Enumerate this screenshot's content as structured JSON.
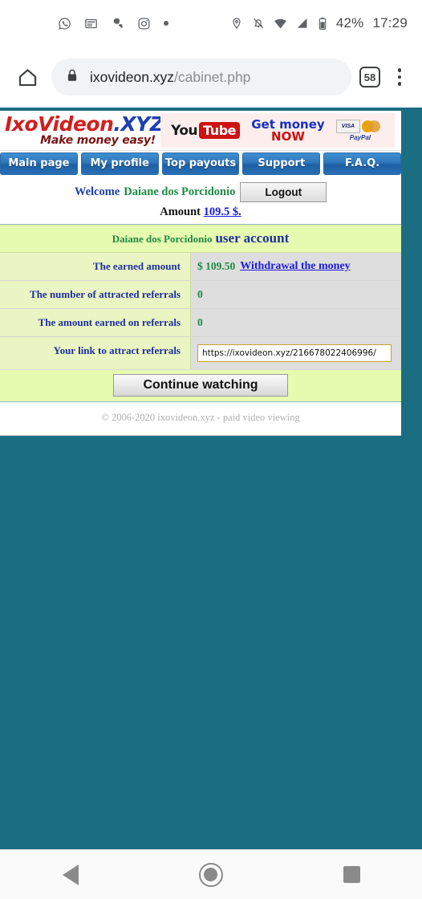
{
  "status_bar": {
    "left_icons": [
      "whatsapp-icon",
      "news-feed-icon",
      "messenger-icon",
      "instagram-icon",
      "more-notifications-dot-icon"
    ],
    "right_icons": [
      "location-pin-icon",
      "notifications-off-icon",
      "wifi-icon",
      "cellular-signal-icon",
      "battery-icon"
    ],
    "battery_percent": "42%",
    "clock": "17:29"
  },
  "browser": {
    "home_icon": "home-icon",
    "lock_icon": "lock-icon",
    "url_host": "ixovideon.xyz",
    "url_path": "/cabinet.php",
    "tab_count": "58",
    "menu_icon": "overflow-menu-icon"
  },
  "site": {
    "logo": {
      "name_part1": "IxoVideon",
      "name_part2": ".XYZ",
      "tagline": "Make money easy!"
    },
    "banner": {
      "youtube_you": "You",
      "youtube_tube": "Tube",
      "headline_line1": "Get money",
      "headline_line2": "NOW",
      "card_visa": "VISA",
      "card_paypal": "PayPal"
    },
    "nav_items": [
      {
        "label": "Main page"
      },
      {
        "label": "My profile"
      },
      {
        "label": "Top payouts"
      },
      {
        "label": "Support"
      },
      {
        "label": "F.A.Q."
      }
    ],
    "welcome": {
      "greeting": "Welcome",
      "username": "Daiane dos Porcidonio",
      "logout_label": "Logout",
      "amount_label": "Amount",
      "amount_value": "109.5 $."
    },
    "account": {
      "header_user": "Daiane dos Porcidonio",
      "header_title": "user account",
      "rows": [
        {
          "label": "The earned amount",
          "value": "$ 109.50",
          "link": "Withdrawal the money"
        },
        {
          "label": "The number of attracted referrals",
          "value": "0"
        },
        {
          "label": "The amount earned on referrals",
          "value": "0"
        }
      ],
      "referral_row_label": "Your link to attract referrals",
      "referral_link_value": "https://ixovideon.xyz/216678022406996/",
      "continue_label": "Continue watching"
    },
    "footer": "© 2006-2020 ixovideon.xyz - paid video viewing"
  },
  "android_navbar": {
    "back_icon": "back-triangle-icon",
    "home_icon": "home-circle-icon",
    "recents_icon": "recents-square-icon"
  },
  "colors": {
    "page_background": "#1b6e82",
    "nav_button": "#2f76bb",
    "accent_green": "#1f8a42",
    "accent_blue": "#1f2f9e",
    "row_label_bg": "#e9f5c2",
    "row_value_bg": "#dedede"
  }
}
